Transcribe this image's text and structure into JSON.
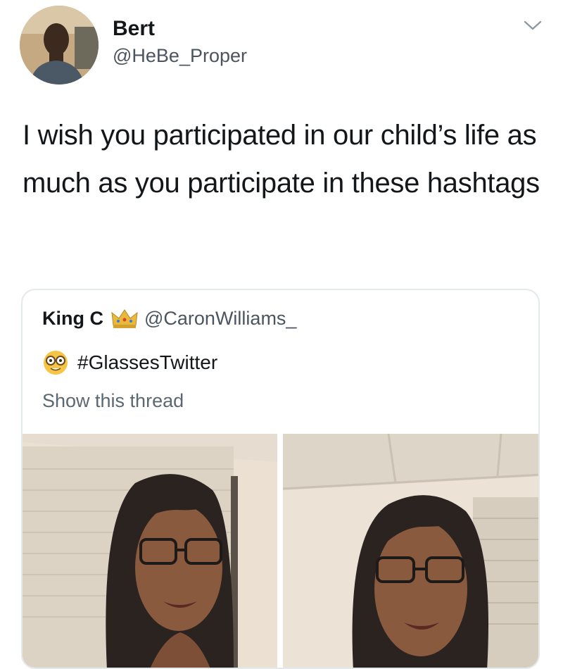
{
  "tweet": {
    "author_name": "Bert",
    "author_handle": "@HeBe_Proper",
    "text": "I wish you participated in our child’s life as much as you participate in these hashtags",
    "avatar_icon": "user-avatar",
    "menu_icon": "chevron-down-icon"
  },
  "quote": {
    "author_name": "King C",
    "author_badge_icon": "crown-emoji-icon",
    "author_handle": "@CaronWilliams_",
    "emoji_icon": "nerd-face-emoji-icon",
    "hashtag": "#GlassesTwitter",
    "show_thread": "Show this thread",
    "photo_count": 2
  },
  "colors": {
    "text_primary": "#14171a",
    "text_secondary": "#5b6872",
    "card_border": "#e4e9ec"
  }
}
